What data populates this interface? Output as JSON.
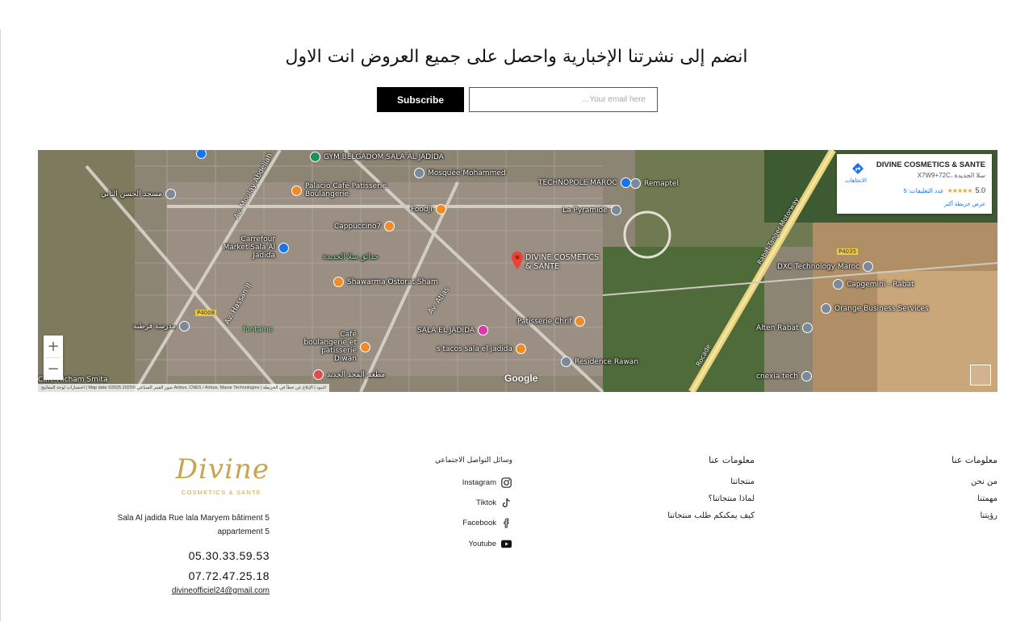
{
  "newsletter": {
    "title": "انضم إلى نشرتنا الإخبارية واحصل على جميع العروض انت الاول",
    "subscribe_label": "Subscribe",
    "email_placeholder": "...Your email here"
  },
  "map": {
    "place_card": {
      "name": "DIVINE COSMETICS & SANTE",
      "address": "X7W9+72C، سلا الجديدة",
      "rating": "5.0",
      "stars": "★★★★★",
      "reviews": "عدد التعليقات: 5",
      "bigger_map": "عرض خريطة أكبر",
      "directions": "الاتجاهات"
    },
    "main_place": [
      "DIVINE COSMETICS",
      "& SANTE"
    ],
    "pois": [
      {
        "label": "GYM BELGADOM SALA AL JADIDA",
        "color": "green"
      },
      {
        "label": "Mosquée Mohammed",
        "color": "grey"
      },
      {
        "label": "TECHNOPOLE MAROC",
        "color": "blue"
      },
      {
        "label": "Remaptel",
        "color": "grey"
      },
      {
        "label": "Palacio Café Patisserie Boulangerie",
        "color": "orange"
      },
      {
        "label": "مسجد الحسن الثاني",
        "color": "grey"
      },
      {
        "label": "Foodji",
        "color": "orange"
      },
      {
        "label": "Cappuccino7",
        "color": "orange"
      },
      {
        "label": "La Pyramide",
        "color": "grey"
      },
      {
        "label": "Carrefour Market Sala Al Jadida",
        "color": "blue"
      },
      {
        "label": "حدائق سلا الجديدة",
        "color": "green"
      },
      {
        "label": "Shawarma Ostorat Sham",
        "color": "orange"
      },
      {
        "label": "DXC Technology Maroc",
        "color": "grey"
      },
      {
        "label": "Capgemini - Rabat",
        "color": "grey"
      },
      {
        "label": "Orange Business Services",
        "color": "grey"
      },
      {
        "label": "Patisserie Chrif",
        "color": "orange"
      },
      {
        "label": "مدرسة قرطبة",
        "color": "grey"
      },
      {
        "label": "Café boulangerie et patisserie Diwan",
        "color": "orange"
      },
      {
        "label": "SALA EL JADIDA",
        "color": "pink"
      },
      {
        "label": "Alten Rabat",
        "color": "grey"
      },
      {
        "label": "s tacos sala el jadida",
        "color": "orange"
      },
      {
        "label": "Residence Rawan",
        "color": "grey"
      },
      {
        "label": "مطعم المجد الجديد",
        "color": "red"
      },
      {
        "label": "cnexia tech",
        "color": "grey"
      },
      {
        "label": "Cafe Hicham Smita",
        "color": "grey"
      }
    ],
    "roads": [
      "Av. Moulay Abdellah",
      "Av. Hassan II",
      "Av. Atlas",
      "Rabat-Tanger Motorway",
      "Rocade",
      "P4008",
      "P4035",
      "fontaine"
    ],
    "google": "Google",
    "attribution": "اختصارات لوحة المفاتيح | Map data ©2025 صور القمر الصناعي ©2025 Airbus, CNES / Airbus, Maxar Technologies | البنود | الإبلاغ عن خطأ في الخريطة",
    "zoom_in": "+",
    "zoom_out": "−"
  },
  "footer": {
    "logo_main": "Divine",
    "logo_sub": "COSMETICS & SANTE",
    "address": "Sala Al jadida Rue lala Maryem bâtiment 5 appartement 5",
    "phone1": "05.30.33.59.53",
    "phone2": "07.72.47.25.18",
    "email": "divineofficiel24@gmail.com",
    "social_title": "وسائل التواصل الاجتماعي",
    "social": [
      {
        "label": "Instagram",
        "icon": "instagram-icon"
      },
      {
        "label": "Tiktok",
        "icon": "tiktok-icon"
      },
      {
        "label": "Facebook",
        "icon": "facebook-icon"
      },
      {
        "label": "Youtube",
        "icon": "youtube-icon"
      }
    ],
    "info_col": {
      "title": "معلومات عنا",
      "links": [
        "منتجاتنا",
        "لماذا منتجاتنا؟",
        "كيف يمكنكم طلب منتجاتنا"
      ]
    },
    "about_col": {
      "title": "معلومات عنا",
      "links": [
        "من نحن",
        "مهمتنا",
        "رؤيتنا"
      ]
    }
  }
}
